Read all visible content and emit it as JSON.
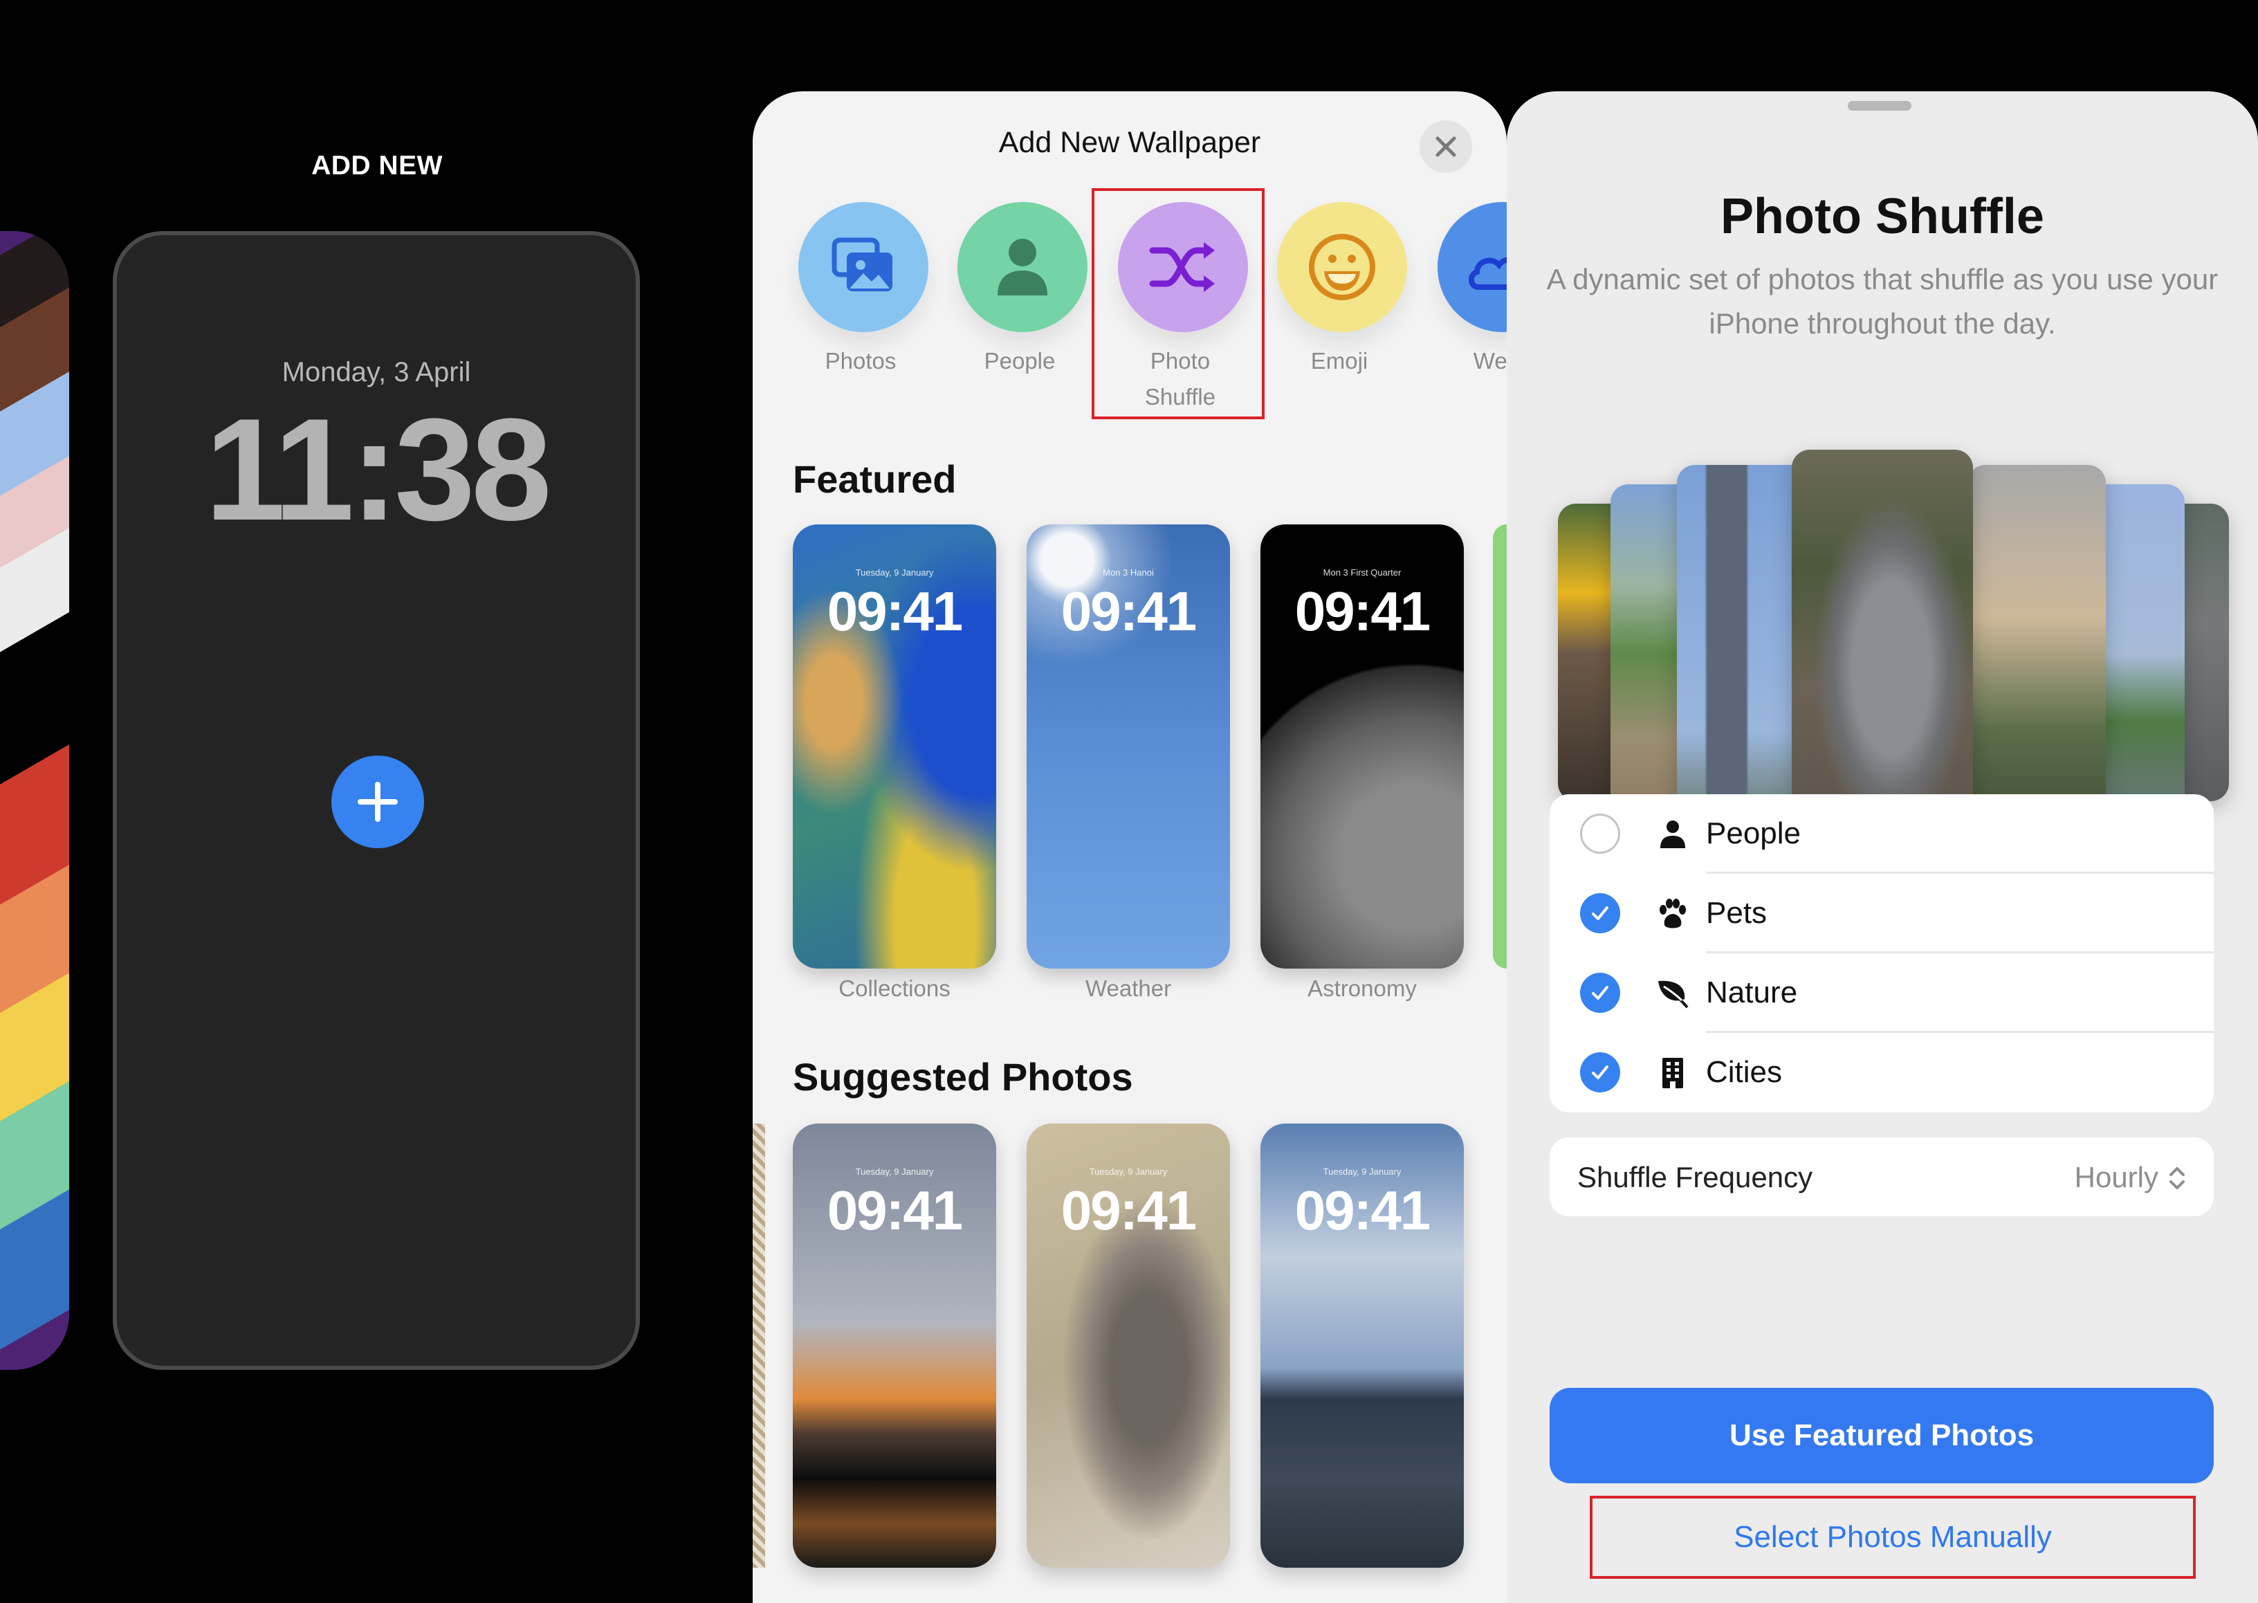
{
  "lockscreen": {
    "header_label": "ADD NEW",
    "date": "Monday, 3 April",
    "time": "11:38",
    "add_button_icon": "plus-icon"
  },
  "add_wallpaper": {
    "title": "Add New Wallpaper",
    "close_icon": "close-icon",
    "categories": [
      {
        "label": "Photos",
        "icon": "photos-icon",
        "color": "#87c4f2",
        "icon_color": "#2a66d6"
      },
      {
        "label": "People",
        "icon": "person-icon",
        "color": "#74d4a6",
        "icon_color": "#3c8060"
      },
      {
        "label": "Photo Shuffle",
        "line1": "Photo",
        "line2": "Shuffle",
        "icon": "shuffle-icon",
        "color": "#c9a2ee",
        "icon_color": "#7b1fd2",
        "highlighted": true
      },
      {
        "label": "Emoji",
        "icon": "emoji-icon",
        "color": "#f5e58a",
        "icon_color": "#d9891c"
      },
      {
        "label": "Weat",
        "icon": "weather-icon",
        "color": "#4f8fe8",
        "icon_color": "#1d3fd0"
      }
    ],
    "featured": {
      "title": "Featured",
      "items": [
        {
          "label": "Collections",
          "date": "Tuesday, 9 January",
          "time": "09:41"
        },
        {
          "label": "Weather",
          "date": "Mon 3  Hanoi",
          "time": "09:41"
        },
        {
          "label": "Astronomy",
          "date": "Mon 3  First Quarter",
          "time": "09:41"
        }
      ]
    },
    "suggested": {
      "title": "Suggested Photos",
      "items": [
        {
          "date": "Tuesday, 9 January",
          "time": "09:41"
        },
        {
          "date": "Tuesday, 9 January",
          "time": "09:41"
        },
        {
          "date": "Tuesday, 9 January",
          "time": "09:41"
        }
      ]
    }
  },
  "photo_shuffle": {
    "title": "Photo Shuffle",
    "subtitle": "A dynamic set of photos that shuffle as you use your iPhone throughout the day.",
    "options": [
      {
        "label": "People",
        "icon": "person-icon",
        "checked": false
      },
      {
        "label": "Pets",
        "icon": "paw-icon",
        "checked": true
      },
      {
        "label": "Nature",
        "icon": "leaf-icon",
        "checked": true
      },
      {
        "label": "Cities",
        "icon": "building-icon",
        "checked": true
      }
    ],
    "frequency": {
      "label": "Shuffle Frequency",
      "value": "Hourly"
    },
    "primary_button": "Use Featured Photos",
    "secondary_button": "Select Photos Manually",
    "accent_color": "#3579f0",
    "highlight_color": "#d9222b"
  }
}
